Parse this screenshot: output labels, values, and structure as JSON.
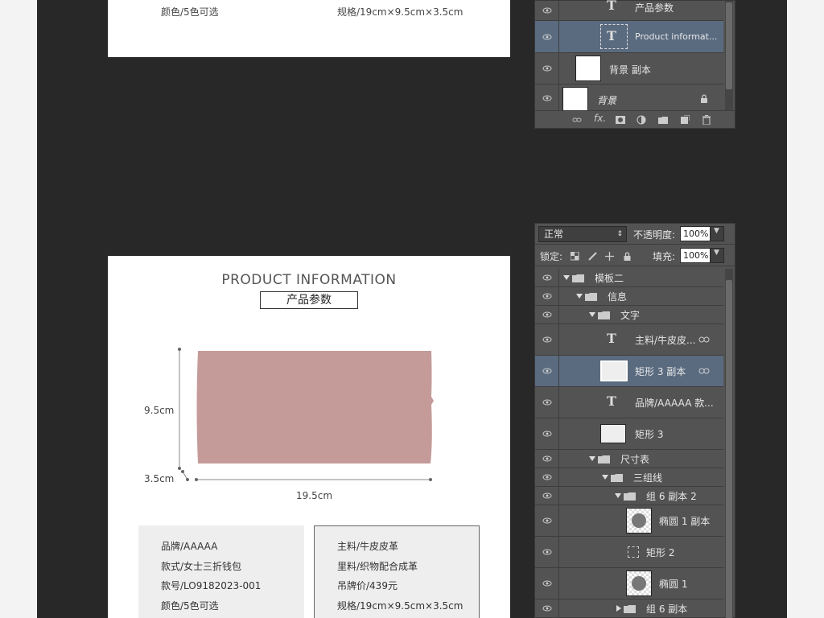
{
  "canvas_top": {
    "color_line": "颜色/5色可选",
    "size_line": "规格/19cm×9.5cm×3.5cm"
  },
  "canvas_main": {
    "title": "PRODUCT INFORMATION",
    "subtitle": "产品参数",
    "product_color": "#c49b99",
    "height_label": "9.5cm",
    "depth_label": "3.5cm",
    "width_label": "19.5cm",
    "left_info": [
      "品牌/AAAAA",
      "款式/女士三折钱包",
      "款号/LO9182023-001",
      "颜色/5色可选"
    ],
    "right_info": [
      "主料/牛皮皮革",
      "里料/织物配合成革",
      "吊牌价/439元",
      "规格/19cm×9.5cm×3.5cm"
    ]
  },
  "layers_panel_top": {
    "layers": [
      {
        "name": "产品参数",
        "type": "text"
      },
      {
        "name": "Product informat...",
        "type": "text",
        "selected": true
      },
      {
        "name": "背景 副本",
        "type": "image"
      },
      {
        "name": "背景",
        "type": "image",
        "locked": true
      }
    ],
    "bottom_icons": [
      "link-icon",
      "fx-icon",
      "mask-icon",
      "adjustment-icon",
      "folder-icon",
      "new-layer-icon",
      "trash-icon"
    ],
    "fx_label": "fx."
  },
  "layers_panel_main": {
    "blend_mode": "正常",
    "opacity_label": "不透明度:",
    "opacity_value": "100%",
    "lock_label": "锁定:",
    "fill_label": "填充:",
    "fill_value": "100%",
    "layers": [
      {
        "name": "模板二",
        "type": "group",
        "expanded": true
      },
      {
        "name": "信息",
        "type": "group",
        "expanded": true
      },
      {
        "name": "文字",
        "type": "group",
        "expanded": true
      },
      {
        "name": "主料/牛皮皮...",
        "type": "text",
        "linked": true
      },
      {
        "name": "矩形 3 副本",
        "type": "shape",
        "linked": true,
        "selected": true
      },
      {
        "name": "品牌/AAAAA 款...",
        "type": "text"
      },
      {
        "name": "矩形 3",
        "type": "shape"
      },
      {
        "name": "尺寸表",
        "type": "group",
        "expanded": true
      },
      {
        "name": "三组线",
        "type": "group",
        "expanded": true
      },
      {
        "name": "组 6 副本 2",
        "type": "group",
        "expanded": true
      },
      {
        "name": "椭圆 1 副本",
        "type": "shape"
      },
      {
        "name": "矩形 2",
        "type": "shape"
      },
      {
        "name": "椭圆 1",
        "type": "shape"
      },
      {
        "name": "组 6 副本",
        "type": "group",
        "expanded": false
      }
    ]
  },
  "colors": {
    "workspace": "#282828",
    "panel": "#535353",
    "selected_layer": "#5a6b80"
  }
}
